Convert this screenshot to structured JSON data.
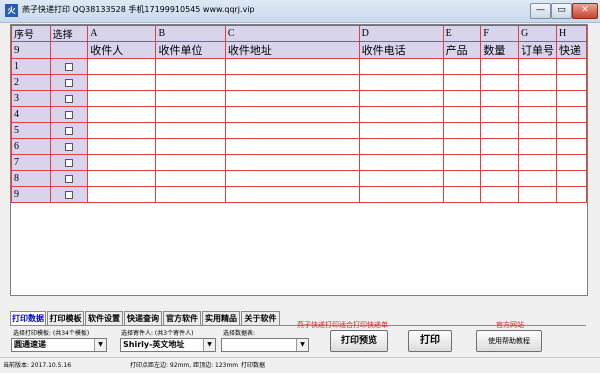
{
  "titlebar": {
    "icon_text": "火",
    "title": "燕子快递打印  QQ38133528  手机17199910545  www.qqrj.vip",
    "buttons": [
      "—",
      "▭",
      "✕"
    ]
  },
  "sheet": {
    "header_row1": [
      "序号",
      "选择",
      "A",
      "B",
      "C",
      "D",
      "E",
      "F",
      "G",
      "H"
    ],
    "header_row2": [
      "9",
      "",
      "收件人",
      "收件单位",
      "收件地址",
      "收件电话",
      "产品",
      "数量",
      "订单号",
      "快递"
    ],
    "rows": [
      "1",
      "2",
      "3",
      "4",
      "5",
      "6",
      "7",
      "8",
      "9"
    ]
  },
  "tabs": [
    "打印数据",
    "打印模板",
    "软件设置",
    "快递查询",
    "官方软件",
    "实用精品",
    "关于软件"
  ],
  "controls": {
    "template_label": "选择打印模板: (共34个模板)",
    "template_value": "圆通速递",
    "sender_label": "选择寄件人: (共3个寄件人)",
    "sender_value": "Shirly-英文地址",
    "datatable_label": "选择数据表:",
    "datatable_value": "",
    "notice": "燕子快递打印适合打印快递单",
    "official_site": "官方网站",
    "preview_button": "打印预览",
    "print_button": "打印",
    "help_button": "使用帮助教程"
  },
  "status": {
    "version": "当前版本: 2017.10.5.16",
    "offsets": "打印点距左边: 92mm, 距顶边: 123mm",
    "mode": "打印数据"
  }
}
